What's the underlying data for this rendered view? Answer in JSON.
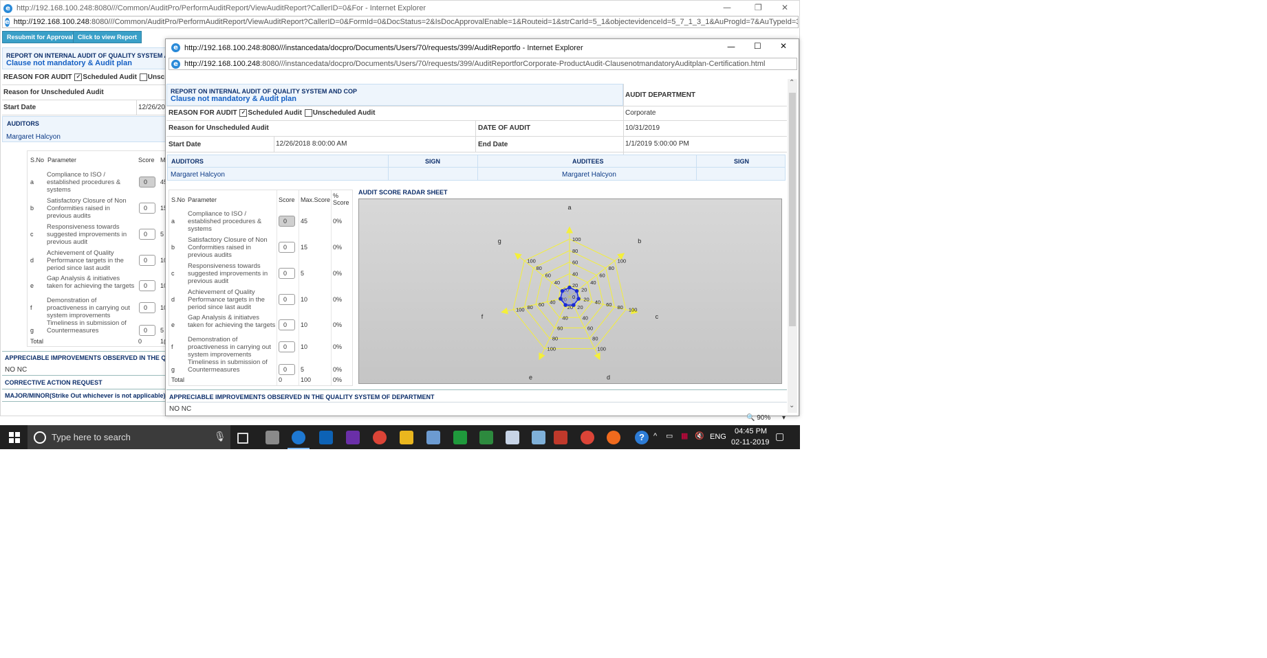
{
  "back_window": {
    "title": "http://192.168.100.248:8080///Common/AuditPro/PerformAuditReport/ViewAuditReport?CallerID=0&For - Internet Explorer",
    "address_host": "http://192.168.100.248",
    "address_rest": ":8080///Common/AuditPro/PerformAuditReport/ViewAuditReport?CallerID=0&FormId=0&DocStatus=2&IsDocApprovalEnable=1&Routeid=1&strCarId=5_1&objectevidenceId=5_7_1_3_1&AuProgId=7&AuTypeId=3&ProcessId=0&",
    "buttons": {
      "resubmit": "Resubmit for Approval",
      "view_report": "Click to view Report"
    },
    "report_title": "REPORT ON INTERNAL AUDIT OF QUALITY SYSTEM AN",
    "report_subtitle": "Clause not mandatory & Audit plan",
    "reason_label": "REASON FOR AUDIT",
    "scheduled": "Scheduled Audit",
    "unscheduled": "Unschedu",
    "unscheduled_reason_label": "Reason for Unscheduled Audit",
    "start_date_label": "Start Date",
    "start_date_value": "12/26/201",
    "auditors_label": "AUDITORS",
    "auditor_name": "Margaret Halcyon",
    "table_headers": {
      "sno": "S.No",
      "param": "Parameter",
      "score": "Score",
      "max": "M"
    },
    "rows": [
      {
        "sno": "a",
        "param": "Compliance to ISO / established procedures & systems",
        "score": "0",
        "max": "45"
      },
      {
        "sno": "b",
        "param": "Satisfactory Closure of Non Conformities raised in previous audits",
        "score": "0",
        "max": "15"
      },
      {
        "sno": "c",
        "param": "Responsiveness towards suggested improvements in previous audit",
        "score": "0",
        "max": "5"
      },
      {
        "sno": "d",
        "param": "Achievement of Quality Performance targets in the period since last audit",
        "score": "0",
        "max": "10"
      },
      {
        "sno": "e",
        "param": "Gap Analysis & initiatives taken for achieving the targets",
        "score": "0",
        "max": "10"
      },
      {
        "sno": "f",
        "param": "Demonstration of proactiveness in carrying out system improvements",
        "score": "0",
        "max": "10"
      },
      {
        "sno": "g",
        "param": "Timeliness in submission of Countermeasures",
        "score": "0",
        "max": "5"
      }
    ],
    "total_label": "Total",
    "total_score": "0",
    "total_max": "1(",
    "appreciable": "APPRECIABLE IMPROVEMENTS OBSERVED IN THE QUA",
    "no_nc": "NO NC",
    "car": "CORRECTIVE ACTION REQUEST",
    "major_minor": "MAJOR/MINOR(Strike Out whichever is not applicable)"
  },
  "front_window": {
    "title": "http://192.168.100.248:8080///instancedata/docpro/Documents/Users/70/requests/399/AuditReportfo - Internet Explorer",
    "address_host": "http://192.168.100.248",
    "address_rest": ":8080///instancedata/docpro/Documents/Users/70/requests/399/AuditReportforCorporate-ProductAudit-ClausenotmandatoryAuditplan-Certification.html",
    "report_title": "REPORT ON INTERNAL AUDIT OF QUALITY SYSTEM AND COP",
    "report_subtitle": "Clause not mandatory & Audit plan",
    "audit_department_label": "AUDIT DEPARTMENT",
    "audit_department_value": "Corporate",
    "reason_label": "REASON FOR AUDIT",
    "scheduled": "Scheduled Audit",
    "unscheduled": "Unscheduled Audit",
    "unscheduled_reason_label": "Reason for Unscheduled Audit",
    "date_of_audit_label": "DATE OF AUDIT",
    "date_of_audit_value": "10/31/2019",
    "start_date_label": "Start Date",
    "start_date_value": "12/26/2018 8:00:00 AM",
    "end_date_label": "End Date",
    "end_date_value": "1/1/2019 5:00:00 PM",
    "auditors_label": "AUDITORS",
    "sign_label": "SIGN",
    "auditees_label": "AUDITEES",
    "sign2_label": "SIGN",
    "auditor_name": "Margaret Halcyon",
    "auditee_name": "Margaret Halcyon",
    "table_headers": {
      "sno": "S.No",
      "param": "Parameter",
      "score": "Score",
      "max": "Max.Score",
      "pct": "% Score"
    },
    "rows": [
      {
        "sno": "a",
        "param": "Compliance to ISO / established procedures & systems",
        "score": "0",
        "max": "45",
        "pct": "0%"
      },
      {
        "sno": "b",
        "param": "Satisfactory Closure of Non Conformities raised in previous audits",
        "score": "0",
        "max": "15",
        "pct": "0%"
      },
      {
        "sno": "c",
        "param": "Responsiveness towards suggested improvements in previous audit",
        "score": "0",
        "max": "5",
        "pct": "0%"
      },
      {
        "sno": "d",
        "param": "Achievement of Quality Performance targets in the period since last audit",
        "score": "0",
        "max": "10",
        "pct": "0%"
      },
      {
        "sno": "e",
        "param": "Gap Analysis & initiatves taken for achieving the targets",
        "score": "0",
        "max": "10",
        "pct": "0%"
      },
      {
        "sno": "f",
        "param": "Demonstration of proactiveness in carrying out system improvements",
        "score": "0",
        "max": "10",
        "pct": "0%"
      },
      {
        "sno": "g",
        "param": "Timeliness in submission of Countermeasures",
        "score": "0",
        "max": "5",
        "pct": "0%"
      }
    ],
    "total_label": "Total",
    "total_score": "0",
    "total_max": "100",
    "total_pct": "0%",
    "radar_title": "AUDIT SCORE RADAR SHEET",
    "appreciable": "APPRECIABLE IMPROVEMENTS OBSERVED IN THE QUALITY SYSTEM OF DEPARTMENT",
    "no_nc": "NO NC",
    "zoom": "90%"
  },
  "chart_data": {
    "type": "radar",
    "axes": [
      "a",
      "b",
      "c",
      "d",
      "e",
      "f",
      "g"
    ],
    "ticks": [
      0,
      20,
      40,
      60,
      80,
      100
    ],
    "range": [
      0,
      100
    ],
    "series": [
      {
        "values": [
          0,
          0,
          0,
          0,
          0,
          0,
          0
        ]
      }
    ],
    "colors": {
      "web": "#f4ef3a",
      "series": "#1a2bd6"
    }
  },
  "taskbar": {
    "search_placeholder": "Type here to search",
    "language": "ENG",
    "time": "04:45 PM",
    "date": "02-11-2019"
  }
}
